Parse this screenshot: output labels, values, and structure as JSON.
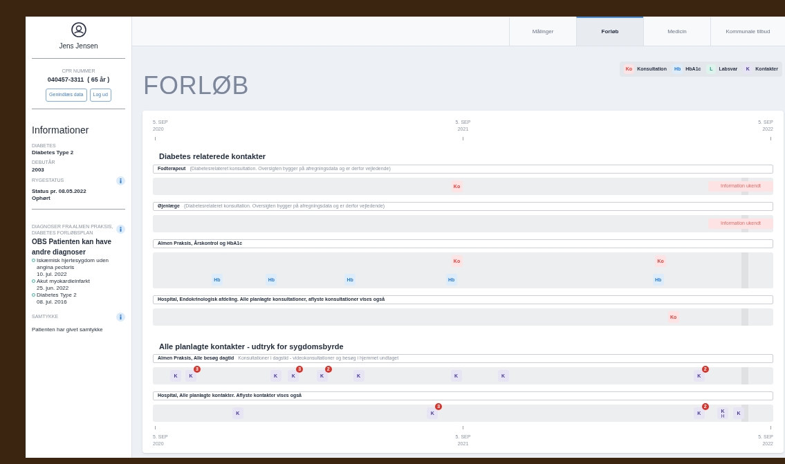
{
  "patient": {
    "name": "Jens Jensen",
    "cpr_label": "CPR NUMMER",
    "cpr": "040457-3311  ( 65 år )",
    "buttons": [
      "Genindlæs data",
      "Log ud"
    ]
  },
  "info": {
    "title": "Informationer",
    "fields": [
      {
        "label": "DIABETES",
        "lines": [
          "Diabetes Type 2"
        ],
        "info": false
      },
      {
        "label": "DEBUTÅR",
        "lines": [
          "2003"
        ],
        "info": false
      },
      {
        "label": "RYGESTATUS",
        "lines": [
          "Status pr. 08.05.2022",
          "Ophørt"
        ],
        "info": true
      }
    ]
  },
  "diagnoses": {
    "label": "DIAGNOSER FRA ALMEN PRAKSIS, DIABETES FORLØBSPLAN",
    "info": true,
    "note": "OBS Patienten kan have andre diagnoser",
    "items": [
      {
        "name": "Iskæmisk hjertesygdom uden angina pectoris",
        "date": "10. jul. 2022"
      },
      {
        "name": "Akut myokardieinfarkt",
        "date": "25. jun. 2022"
      },
      {
        "name": "Diabetes Type 2",
        "date": "08. jul. 2016"
      }
    ]
  },
  "consent": {
    "label": "SAMTYKKE",
    "info": true,
    "text": "Patienten har givet samtykke"
  },
  "tabs": [
    {
      "label": "Målinger",
      "selected": false
    },
    {
      "label": "Forløb",
      "selected": true
    },
    {
      "label": "Medicin",
      "selected": false
    },
    {
      "label": "Kommunale tilbud",
      "selected": false
    }
  ],
  "page_title": "FORLØB",
  "legend": [
    {
      "kind": "ko",
      "code": "Ko",
      "label": "Konsultation"
    },
    {
      "kind": "hb",
      "code": "Hb",
      "label": "HbA1c"
    },
    {
      "kind": "l",
      "code": "L",
      "label": "Labsvar"
    },
    {
      "kind": "k",
      "code": "K",
      "label": "Kontakter"
    }
  ],
  "ticks_top": [
    {
      "day": "5. SEP",
      "year": "2020"
    },
    {
      "day": "5. SEP",
      "year": "2021"
    },
    {
      "day": "5. SEP",
      "year": "2022"
    }
  ],
  "sections": [
    {
      "title": "Diabetes relaterede kontakter",
      "groups": [
        {
          "name": "Fodterapeut",
          "note": "(Diabetesrelateret konsultation. Oversigten bygger på afregningsdata og er derfor vejledende)",
          "lanes": [
            [
              {
                "kind": "ko",
                "label": "Ko",
                "level": 0.487
              },
              {
                "kind": "unknown",
                "label": "Information ukendt"
              }
            ]
          ]
        },
        {
          "name": "Øjenlæge",
          "note": "(Diabetesrelateret konsultation. Oversigten bygger på afregningsdata og er derfor vejledende)",
          "lanes": [
            [
              {
                "kind": "unknown",
                "label": "Information ukendt"
              }
            ]
          ]
        },
        {
          "name": "Almen Praksis, Årskontrol og HbA1c",
          "lanes": [
            [
              {
                "kind": "ko",
                "label": "Ko",
                "level": 0.487
              },
              {
                "kind": "ko",
                "label": "Ko",
                "level": 0.821
              }
            ],
            [
              {
                "kind": "hb",
                "label": "Hb",
                "level": 0.094
              },
              {
                "kind": "hb",
                "label": "Hb",
                "level": 0.183
              },
              {
                "kind": "hb",
                "label": "Hb",
                "level": 0.312
              },
              {
                "kind": "hb",
                "label": "Hb",
                "level": 0.478
              },
              {
                "kind": "hb",
                "label": "Hb",
                "level": 0.817
              }
            ]
          ]
        },
        {
          "name": "Hospital, Endokrinologisk afdeling. Alle planlagte konsultationer, aflyste konsultationer vises også",
          "lanes": [
            [
              {
                "kind": "ko",
                "label": "Ko",
                "level": 0.842
              }
            ]
          ]
        }
      ]
    },
    {
      "title": "Alle planlagte kontakter - udtryk for sygdomsbyrde",
      "groups": [
        {
          "name": "Almen Praksis, Alle besøg dagtid",
          "note": "Konsultationer i dagstid - videokonsultationer og besøg i hjemmet undtaget",
          "lanes": [
            [
              {
                "kind": "k",
                "label": "K",
                "level": 0.026
              },
              {
                "kind": "k",
                "label": "K",
                "level": 0.051,
                "badge": "3"
              },
              {
                "kind": "k",
                "label": "K",
                "level": 0.19
              },
              {
                "kind": "k",
                "label": "K",
                "level": 0.219,
                "badge": "3"
              },
              {
                "kind": "k",
                "label": "K",
                "level": 0.266,
                "badge": "2"
              },
              {
                "kind": "k",
                "label": "K",
                "level": 0.326
              },
              {
                "kind": "k",
                "label": "K",
                "level": 0.486
              },
              {
                "kind": "k",
                "label": "K",
                "level": 0.563
              },
              {
                "kind": "k",
                "label": "K",
                "level": 0.884,
                "badge": "2"
              }
            ]
          ]
        },
        {
          "name": "Hospital, Alle planlagte kontakter. Aflyste kontakter vises også",
          "lanes": [
            [
              {
                "kind": "k",
                "label": "K",
                "level": 0.128
              },
              {
                "kind": "k",
                "label": "K",
                "level": 0.447,
                "badge": "3"
              },
              {
                "kind": "k",
                "label": "K",
                "level": 0.884,
                "badge": "2"
              },
              {
                "kind": "k",
                "label": "K",
                "level": 0.923,
                "sub": "H"
              },
              {
                "kind": "k",
                "label": "K",
                "level": 0.949
              }
            ]
          ]
        }
      ]
    }
  ],
  "ticks_bottom": [
    {
      "day": "5. SEP",
      "year": "2020"
    },
    {
      "day": "5. SEP",
      "year": "2021"
    },
    {
      "day": "5. SEP",
      "year": "2022"
    }
  ]
}
